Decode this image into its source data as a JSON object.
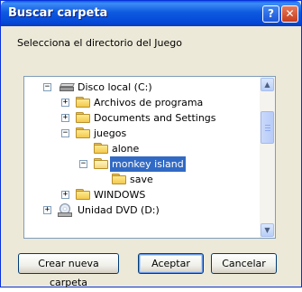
{
  "window": {
    "title": "Buscar carpeta",
    "help_glyph": "?",
    "close_glyph": "✕"
  },
  "prompt": "Selecciona el directorio del Juego",
  "tree": {
    "items": [
      {
        "label": "Disco local (C:)",
        "expander": "−",
        "icon": "hard-drive-icon"
      },
      {
        "label": "Archivos de programa",
        "expander": "+",
        "icon": "folder-icon"
      },
      {
        "label": "Documents and Settings",
        "expander": "+",
        "icon": "folder-icon"
      },
      {
        "label": "juegos",
        "expander": "−",
        "icon": "folder-icon"
      },
      {
        "label": "alone",
        "expander": "",
        "icon": "folder-icon"
      },
      {
        "label": "monkey island",
        "expander": "−",
        "icon": "open-folder-icon",
        "selected": true
      },
      {
        "label": "save",
        "expander": "",
        "icon": "folder-icon"
      },
      {
        "label": "WINDOWS",
        "expander": "+",
        "icon": "folder-icon"
      },
      {
        "label": "Unidad DVD (D:)",
        "expander": "+",
        "icon": "dvd-drive-icon"
      }
    ]
  },
  "scrollbar": {
    "up_glyph": "▲",
    "down_glyph": "▼"
  },
  "buttons": {
    "new_folder": "Crear nueva carpeta",
    "ok": "Aceptar",
    "cancel": "Cancelar"
  },
  "colors": {
    "title_bar": "#0a5ee9",
    "selection": "#316ac5",
    "dialog_bg": "#ece9d8"
  }
}
